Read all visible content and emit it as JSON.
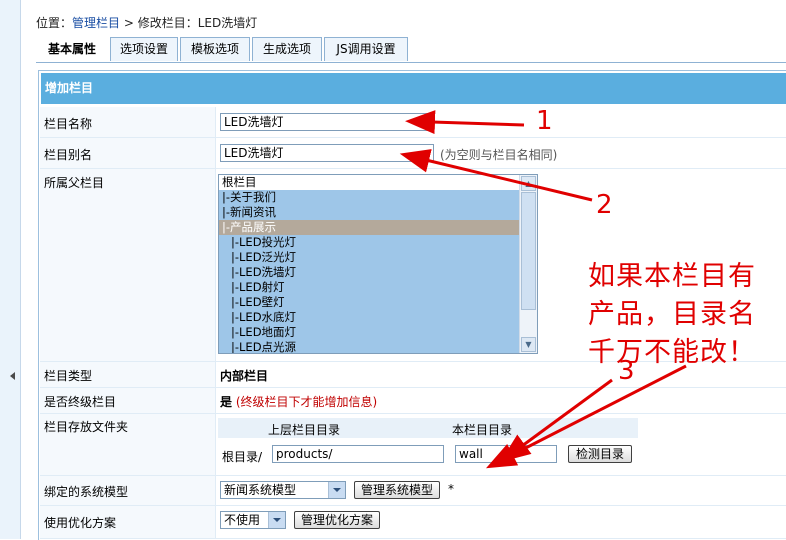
{
  "breadcrumb": {
    "prefix": "位置：",
    "link": "管理栏目",
    "sep": " > ",
    "current": "修改栏目：LED洗墙灯"
  },
  "tabs": [
    "基本属性",
    "选项设置",
    "模板选项",
    "生成选项",
    "JS调用设置"
  ],
  "panel_title": "增加栏目",
  "fields": {
    "name": {
      "label": "栏目名称",
      "value": "LED洗墙灯"
    },
    "alias": {
      "label": "栏目别名",
      "value": "LED洗墙灯",
      "hint": "(为空则与栏目名相同)"
    },
    "parent": {
      "label": "所属父栏目",
      "options": [
        {
          "text": "根栏目",
          "state": "normal",
          "indent": false
        },
        {
          "text": "|-关于我们",
          "state": "sel",
          "indent": false
        },
        {
          "text": "|-新闻资讯",
          "state": "sel",
          "indent": false
        },
        {
          "text": "|-产品展示",
          "state": "cur",
          "indent": false
        },
        {
          "text": "|-LED投光灯",
          "state": "sel",
          "indent": true
        },
        {
          "text": "|-LED泛光灯",
          "state": "sel",
          "indent": true
        },
        {
          "text": "|-LED洗墙灯",
          "state": "sel",
          "indent": true
        },
        {
          "text": "|-LED射灯",
          "state": "sel",
          "indent": true
        },
        {
          "text": "|-LED壁灯",
          "state": "sel",
          "indent": true
        },
        {
          "text": "|-LED水底灯",
          "state": "sel",
          "indent": true
        },
        {
          "text": "|-LED地面灯",
          "state": "sel",
          "indent": true
        },
        {
          "text": "|-LED点光源",
          "state": "sel",
          "indent": true
        }
      ]
    },
    "type": {
      "label": "栏目类型",
      "value": "内部栏目"
    },
    "final": {
      "label": "是否终级栏目",
      "value": "是",
      "note": "(终级栏目下才能增加信息)"
    },
    "folder": {
      "label": "栏目存放文件夹",
      "col_parent": "上层栏目目录",
      "col_this": "本栏目目录",
      "root_label": "根目录/",
      "parent_value": "products/",
      "this_value": "wall",
      "check_button": "检测目录"
    },
    "model": {
      "label": "绑定的系统模型",
      "value": "新闻系统模型",
      "button": "管理系统模型",
      "star": "*"
    },
    "optimize": {
      "label": "使用优化方案",
      "value": "不使用",
      "button": "管理优化方案"
    }
  },
  "annotations": {
    "n1": "1",
    "n2": "2",
    "n3": "3",
    "note": "如果本栏目有产品，目录名千万不能改！"
  },
  "colors": {
    "header_bg": "#5aaedf",
    "annotation": "#e00000",
    "link": "#1a4ea3",
    "selection": "#9ec6e8"
  }
}
